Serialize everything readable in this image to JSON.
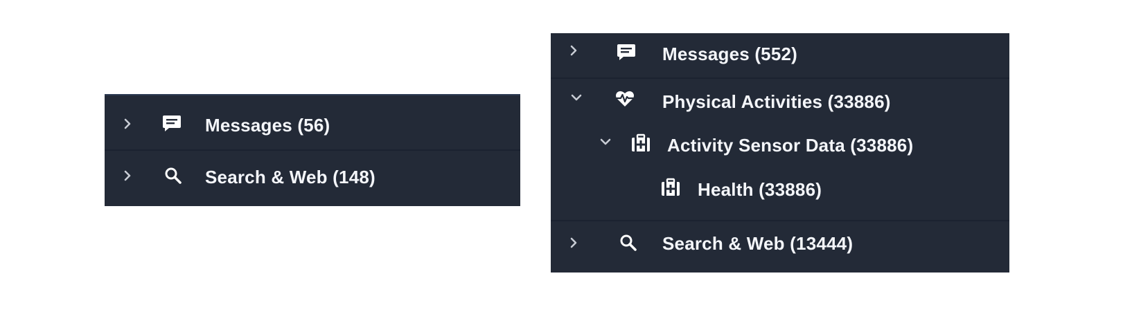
{
  "left_panel": {
    "items": [
      {
        "label": "Messages (56)",
        "icon": "message-icon",
        "expanded": false
      },
      {
        "label": "Search & Web (148)",
        "icon": "search-icon",
        "expanded": false
      }
    ]
  },
  "right_panel": {
    "items": [
      {
        "label": "Messages (552)",
        "icon": "message-icon",
        "expanded": false,
        "level": 0
      },
      {
        "label": "Physical Activities (33886)",
        "icon": "heart-pulse-icon",
        "expanded": true,
        "level": 0
      },
      {
        "label": "Activity Sensor Data (33886)",
        "icon": "medkit-icon",
        "expanded": true,
        "level": 1
      },
      {
        "label": "Health (33886)",
        "icon": "medkit-icon",
        "level": 2
      },
      {
        "label": "Search & Web (13444)",
        "icon": "search-icon",
        "expanded": false,
        "level": 0
      }
    ]
  },
  "colors": {
    "panel_bg": "#232a37",
    "divider": "#1b2230",
    "text": "#f4f6fa",
    "icon": "#ffffff"
  }
}
